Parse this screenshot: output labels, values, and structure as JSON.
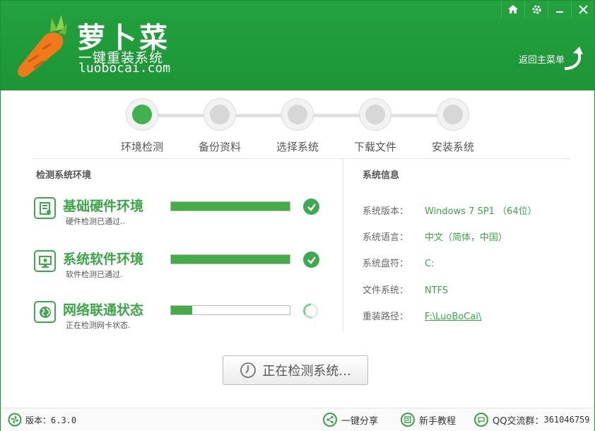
{
  "app": {
    "brand_title": "萝卜菜",
    "brand_slogan": "一键重装系统",
    "brand_domain": "luobocai.com",
    "back_main_label": "返回主菜单"
  },
  "window_controls": [
    "home-icon",
    "gear-icon",
    "minimize-icon",
    "close-icon"
  ],
  "steps": [
    {
      "label": "环境检测",
      "active": true
    },
    {
      "label": "备份资料",
      "active": false
    },
    {
      "label": "选择系统",
      "active": false
    },
    {
      "label": "下载文件",
      "active": false
    },
    {
      "label": "安装系统",
      "active": false
    }
  ],
  "detect": {
    "section_title": "检测系统环境",
    "items": [
      {
        "title": "基础硬件环境",
        "sub": "硬件检测已通过..",
        "progress": 1.0,
        "status": "done",
        "icon": "hardware-icon"
      },
      {
        "title": "系统软件环境",
        "sub": "软件检测已通过.",
        "progress": 1.0,
        "status": "done",
        "icon": "monitor-icon"
      },
      {
        "title": "网络联通状态",
        "sub": "正在检测网卡状态.",
        "progress": 0.18,
        "status": "loading",
        "icon": "globe-icon"
      }
    ]
  },
  "sysinfo": {
    "section_title": "系统信息",
    "rows": [
      {
        "label": "系统版本：",
        "value": "Windows 7 SP1 （64位）"
      },
      {
        "label": "系统语言：",
        "value": "中文（简体，中国）"
      },
      {
        "label": "系统盘符：",
        "value": "C:"
      },
      {
        "label": "文件系统：",
        "value": "NTFS"
      },
      {
        "label": "重装路径：",
        "value": "F:\\LuoBoCai\\"
      }
    ]
  },
  "main_button": {
    "label": "正在检测系统..."
  },
  "footer": {
    "version": "版本：6.3.0",
    "share": "一键分享",
    "tutorial": "新手教程",
    "qq_label": "QQ交流群：",
    "qq_number": "361046759"
  },
  "colors": {
    "brand_green": "#1f9a38",
    "accent_green": "#3aa646"
  }
}
